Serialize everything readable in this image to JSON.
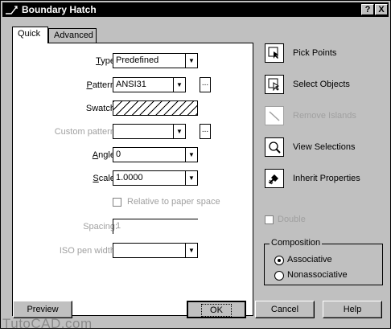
{
  "window": {
    "title": "Boundary Hatch",
    "help_btn": "?",
    "close_btn": "X"
  },
  "tabs": [
    {
      "label": "Quick"
    },
    {
      "label": "Advanced"
    }
  ],
  "fields": {
    "type": {
      "label": "Type:",
      "value": "Predefined"
    },
    "pattern": {
      "label": "Pattern:",
      "value": "ANSI31",
      "ellipsis": "..."
    },
    "swatch": {
      "label": "Swatch:"
    },
    "custom_pattern": {
      "label": "Custom pattern:",
      "value": "",
      "ellipsis": "..."
    },
    "angle": {
      "label": "Angle:",
      "value": "0"
    },
    "scale": {
      "label": "Scale:",
      "value": "1.0000"
    },
    "relative_paper": {
      "label": "Relative to paper space"
    },
    "spacing": {
      "label": "Spacing:",
      "value": "1"
    },
    "iso_pen": {
      "label": "ISO pen width:",
      "value": ""
    }
  },
  "side_buttons": [
    {
      "label": "Pick Points",
      "icon": "pick-points-icon",
      "enabled": true
    },
    {
      "label": "Select Objects",
      "icon": "select-objects-icon",
      "enabled": true
    },
    {
      "label": "Remove Islands",
      "icon": "remove-islands-icon",
      "enabled": false
    },
    {
      "label": "View Selections",
      "icon": "view-selections-icon",
      "enabled": true
    },
    {
      "label": "Inherit Properties",
      "icon": "inherit-properties-icon",
      "enabled": true
    }
  ],
  "double": {
    "label": "Double"
  },
  "composition": {
    "title": "Composition",
    "options": [
      {
        "label": "Associative",
        "selected": true
      },
      {
        "label": "Nonassociative",
        "selected": false
      }
    ]
  },
  "buttons": {
    "preview": "Preview",
    "ok": "OK",
    "cancel": "Cancel",
    "help": "Help"
  },
  "watermark": "TutoCAD.com"
}
